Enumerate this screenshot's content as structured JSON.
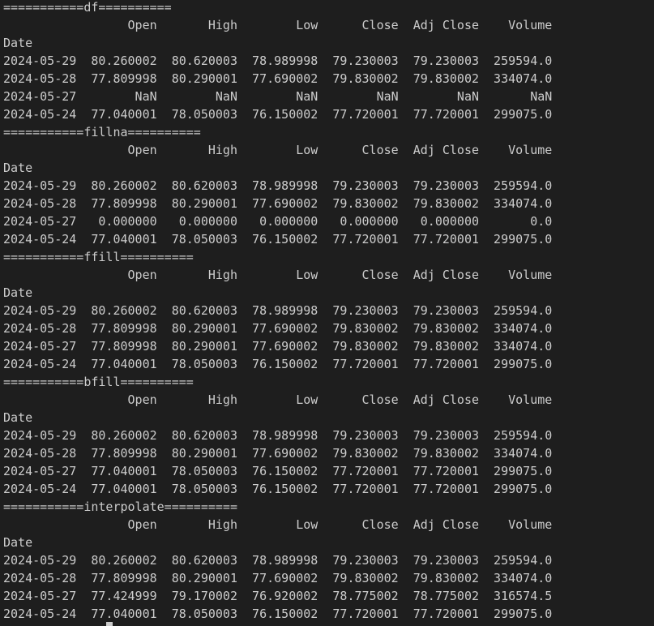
{
  "terminal": {
    "lines": [
      "===========df==========",
      "                 Open       High        Low      Close  Adj Close    Volume",
      "Date",
      "2024-05-29  80.260002  80.620003  78.989998  79.230003  79.230003  259594.0",
      "2024-05-28  77.809998  80.290001  77.690002  79.830002  79.830002  334074.0",
      "2024-05-27        NaN        NaN        NaN        NaN        NaN       NaN",
      "2024-05-24  77.040001  78.050003  76.150002  77.720001  77.720001  299075.0",
      "===========fillna==========",
      "                 Open       High        Low      Close  Adj Close    Volume",
      "Date",
      "2024-05-29  80.260002  80.620003  78.989998  79.230003  79.230003  259594.0",
      "2024-05-28  77.809998  80.290001  77.690002  79.830002  79.830002  334074.0",
      "2024-05-27   0.000000   0.000000   0.000000   0.000000   0.000000       0.0",
      "2024-05-24  77.040001  78.050003  76.150002  77.720001  77.720001  299075.0",
      "===========ffill==========",
      "                 Open       High        Low      Close  Adj Close    Volume",
      "Date",
      "2024-05-29  80.260002  80.620003  78.989998  79.230003  79.230003  259594.0",
      "2024-05-28  77.809998  80.290001  77.690002  79.830002  79.830002  334074.0",
      "2024-05-27  77.809998  80.290001  77.690002  79.830002  79.830002  334074.0",
      "2024-05-24  77.040001  78.050003  76.150002  77.720001  77.720001  299075.0",
      "===========bfill==========",
      "                 Open       High        Low      Close  Adj Close    Volume",
      "Date",
      "2024-05-29  80.260002  80.620003  78.989998  79.230003  79.230003  259594.0",
      "2024-05-28  77.809998  80.290001  77.690002  79.830002  79.830002  334074.0",
      "2024-05-27  77.040001  78.050003  76.150002  77.720001  77.720001  299075.0",
      "2024-05-24  77.040001  78.050003  76.150002  77.720001  77.720001  299075.0",
      "===========interpolate==========",
      "                 Open       High        Low      Close  Adj Close    Volume",
      "Date",
      "2024-05-29  80.260002  80.620003  78.989998  79.230003  79.230003  259594.0",
      "2024-05-28  77.809998  80.290001  77.690002  79.830002  79.830002  334074.0",
      "2024-05-27  77.424999  79.170002  76.920002  78.775002  78.775002  316574.5",
      "2024-05-24  77.040001  78.050003  76.150002  77.720001  77.720001  299075.0"
    ]
  },
  "colors": {
    "background": "#1e1e1e",
    "text": "#cccccc"
  }
}
